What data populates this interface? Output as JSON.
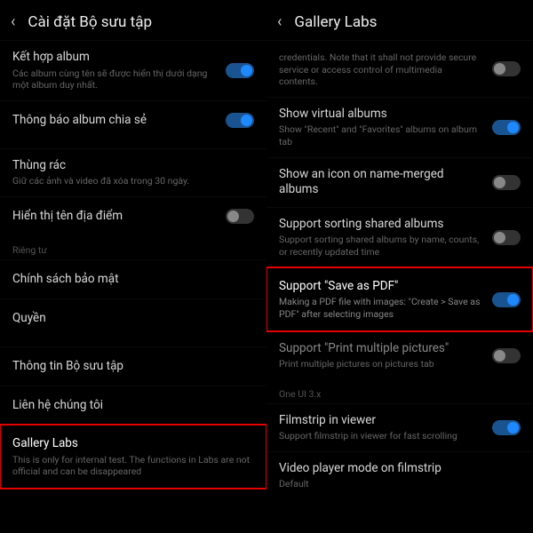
{
  "left": {
    "title": "Cài đặt Bộ sưu tập",
    "items": [
      {
        "label": "Kết hợp album",
        "sub": "Các album cùng tên sẽ được hiển thị dưới dạng một album duy nhất.",
        "toggle": true,
        "on": true
      },
      {
        "label": "Thông báo album chia sẻ",
        "toggle": true,
        "on": true
      },
      {
        "label": "Thùng rác",
        "sub": "Giữ các ảnh và video đã xóa trong 30 ngày.",
        "toggle": false
      },
      {
        "label": "Hiển thị tên địa điểm",
        "toggle": true,
        "on": false
      }
    ],
    "section1": "Riêng tư",
    "priv": [
      {
        "label": "Chính sách bảo mật"
      },
      {
        "label": "Quyền"
      }
    ],
    "info": [
      {
        "label": "Thông tin Bộ sưu tập"
      },
      {
        "label": "Liên hệ chúng tôi"
      }
    ],
    "labs": {
      "label": "Gallery Labs",
      "sub": "This is only for internal test. The functions in Labs are not official and can be disappeared"
    }
  },
  "right": {
    "title": "Gallery Labs",
    "first": {
      "sub": "credentials. Note that it shall not provide secure service or access control of multimedia contents.",
      "on": false
    },
    "items": [
      {
        "label": "Show virtual albums",
        "sub": "Show \"Recent\" and \"Favorites\" albums on album tab",
        "on": true
      },
      {
        "label": "Show an icon on name-merged albums",
        "on": false
      },
      {
        "label": "Support sorting shared albums",
        "sub": "Support sorting shared albums by name, counts, or recently updated time",
        "on": false
      },
      {
        "label": "Support \"Save as PDF\"",
        "sub": "Making a PDF file with images: \"Create > Save as PDF\" after selecting images",
        "on": true,
        "hl": true
      },
      {
        "label": "Support \"Print multiple pictures\"",
        "sub": "Print multiple pictures on pictures tab",
        "on": false
      }
    ],
    "section1": "One UI 3.x",
    "ui3": [
      {
        "label": "Filmstrip in viewer",
        "sub": "Support filmstrip in viewer for fast scrolling",
        "on": true
      },
      {
        "label": "Video player mode on filmstrip",
        "sub": "Default"
      }
    ]
  }
}
